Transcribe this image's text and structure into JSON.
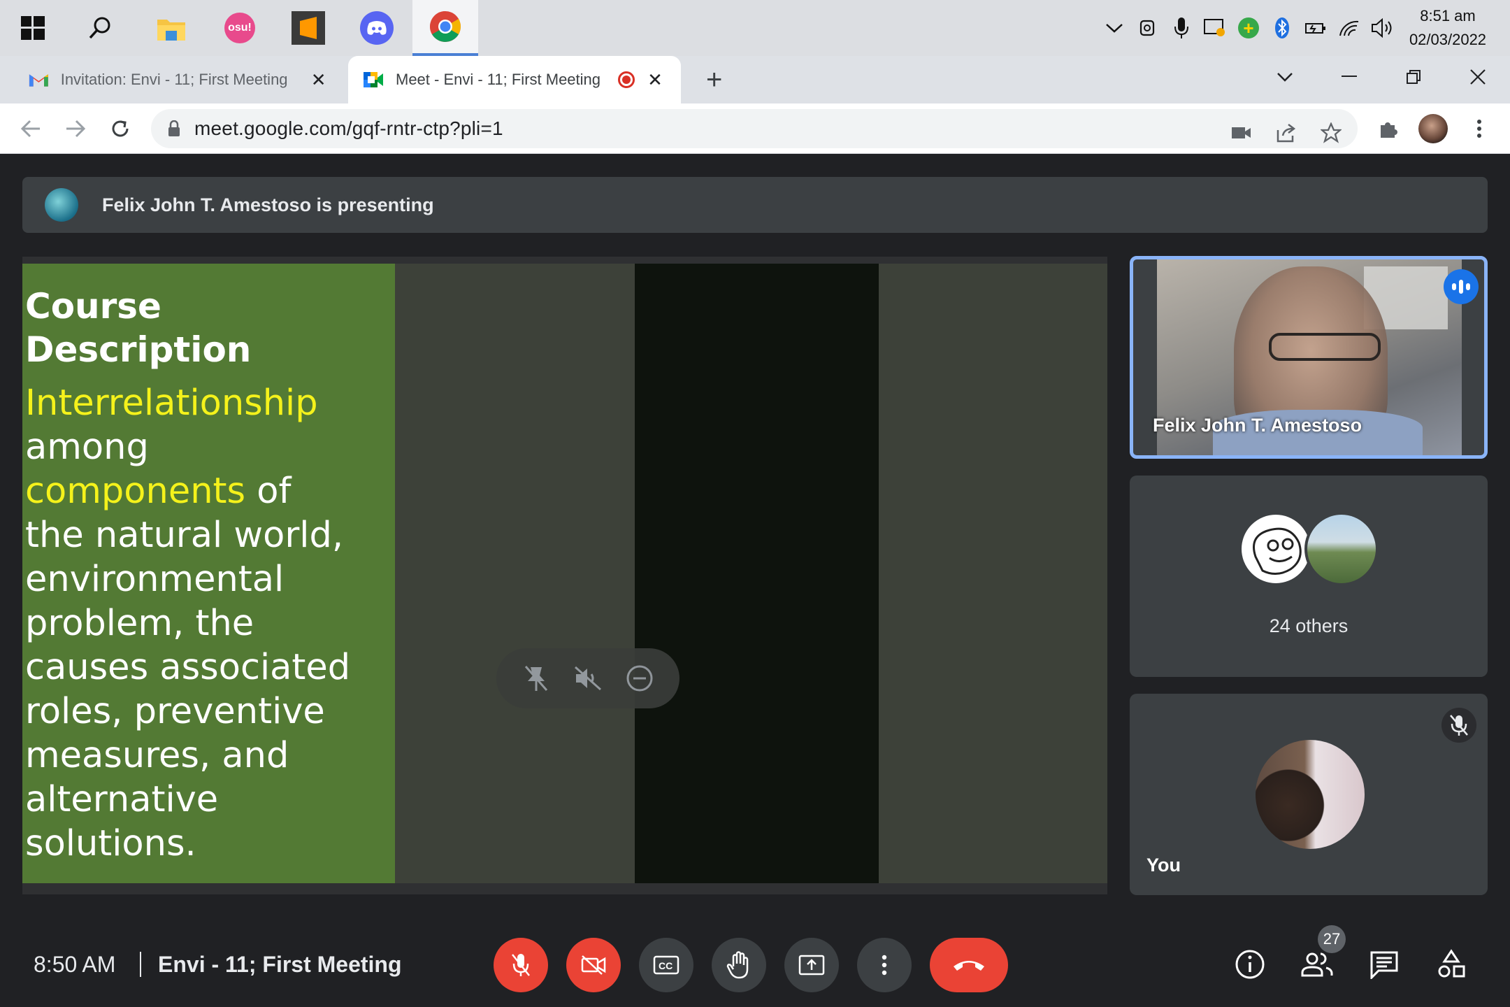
{
  "taskbar": {
    "apps": [
      {
        "name": "start",
        "icon": "windows-logo-icon"
      },
      {
        "name": "search",
        "icon": "search-icon"
      },
      {
        "name": "file-explorer",
        "icon": "folder-icon"
      },
      {
        "name": "osu",
        "label": "osu!",
        "icon": "osu-icon"
      },
      {
        "name": "sublime",
        "icon": "sublime-text-icon"
      },
      {
        "name": "discord",
        "icon": "discord-icon"
      },
      {
        "name": "chrome",
        "icon": "chrome-icon",
        "active": true
      }
    ],
    "clock": {
      "time": "8:51 am",
      "date": "02/03/2022"
    }
  },
  "browser": {
    "tabs": [
      {
        "title": "Invitation: Envi - 11; First Meeting",
        "favicon": "gmail-icon",
        "active": false
      },
      {
        "title": "Meet - Envi - 11; First Meeting",
        "favicon": "meet-icon",
        "active": true,
        "recording": true
      }
    ],
    "new_tab": "+",
    "url": "meet.google.com/gqf-rntr-ctp?pli=1"
  },
  "meet": {
    "banner_text": "Felix John T. Amestoso is presenting",
    "slide": {
      "title_line1": "Course",
      "title_line2": "Description",
      "body": [
        {
          "text": "Interrelationship",
          "highlight": true
        },
        {
          "text": "among",
          "highlight": false
        },
        {
          "text": "components",
          "highlight": true,
          "suffix": " of"
        },
        {
          "text": "the natural world,",
          "highlight": false
        },
        {
          "text": "environmental",
          "highlight": false
        },
        {
          "text": "problem, the",
          "highlight": false
        },
        {
          "text": "causes associated",
          "highlight": false
        },
        {
          "text": "roles, preventive",
          "highlight": false
        },
        {
          "text": "measures, and",
          "highlight": false
        },
        {
          "text": "alternative",
          "highlight": false
        },
        {
          "text": "solutions.",
          "highlight": false
        }
      ],
      "colors": {
        "green": "#537a34",
        "highlight": "#f5f21b"
      }
    },
    "participants": {
      "presenter_name": "Felix John T. Amestoso",
      "others_label": "24 others",
      "self_label": "You"
    },
    "footer": {
      "time": "8:50 AM",
      "meeting_title": "Envi - 11; First Meeting",
      "people_count": "27"
    },
    "accent": "#8ab4f8",
    "danger": "#ea4335"
  }
}
